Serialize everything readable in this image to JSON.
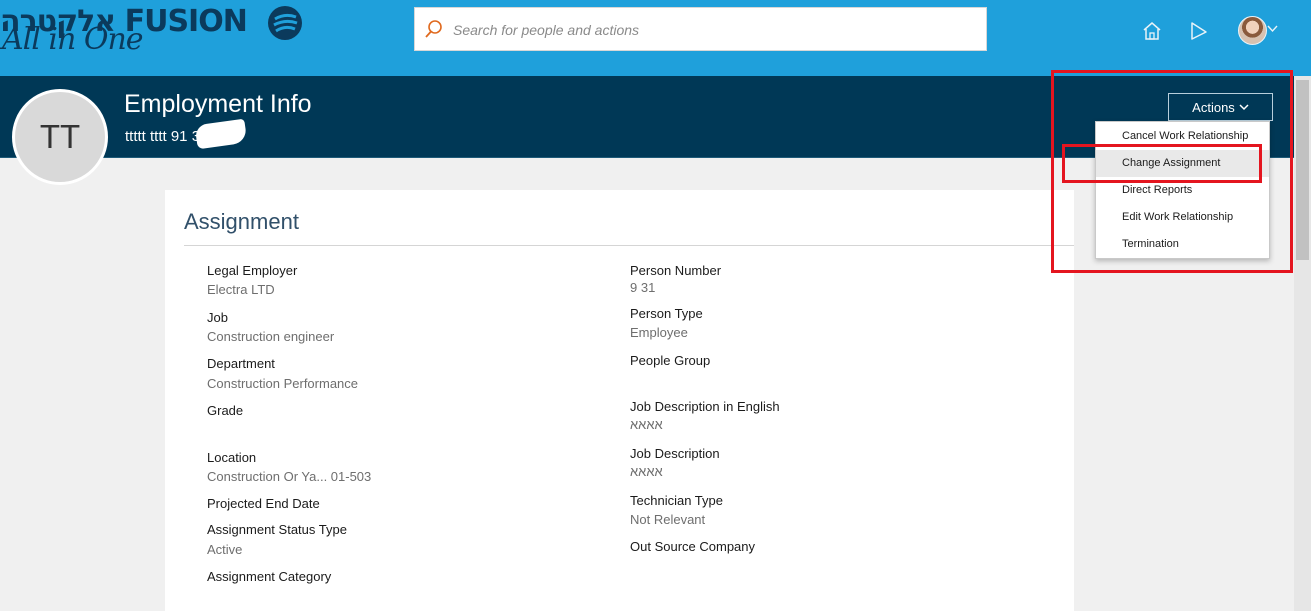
{
  "brand": {
    "logo_text": "אלקטרה FUSION",
    "logo_tagline": "All in One"
  },
  "search": {
    "placeholder": "Search for people and actions"
  },
  "header_icons": [
    "home-icon",
    "navigator-icon",
    "user-avatar"
  ],
  "page": {
    "title": "Employment Info",
    "avatar_initials": "TT",
    "person_subtitle": "ttttt tttt 91   31"
  },
  "actions": {
    "label": "Actions",
    "menu": [
      "Cancel Work Relationship",
      "Change Assignment",
      "Direct Reports",
      "Edit Work Relationship",
      "Termination"
    ],
    "highlighted_index": 1
  },
  "assignment": {
    "title": "Assignment",
    "left": [
      {
        "label": "Legal Employer",
        "value": "Electra LTD"
      },
      {
        "label": "Job",
        "value": "Construction engineer"
      },
      {
        "label": "Department",
        "value": "Construction Performance"
      },
      {
        "label": "Grade",
        "value": ""
      },
      {
        "label": "Location",
        "value": "Construction Or Ya...   01-503"
      },
      {
        "label": "Projected End Date",
        "value": ""
      },
      {
        "label": "Assignment Status Type",
        "value": "Active"
      },
      {
        "label": "Assignment Category",
        "value": ""
      }
    ],
    "right": [
      {
        "label": "Person Number",
        "value": "9   31"
      },
      {
        "label": "Person Type",
        "value": "Employee"
      },
      {
        "label": "People Group",
        "value": ""
      },
      {
        "label": "Job Description in English",
        "value": "אאאא"
      },
      {
        "label": "Job Description",
        "value": "אאאא"
      },
      {
        "label": "Technician Type",
        "value": "Not Relevant"
      },
      {
        "label": "Out Source Company",
        "value": ""
      }
    ]
  },
  "colors": {
    "top_bar": "#1fa0db",
    "page_band": "#003856",
    "annotation": "#e4151f"
  }
}
